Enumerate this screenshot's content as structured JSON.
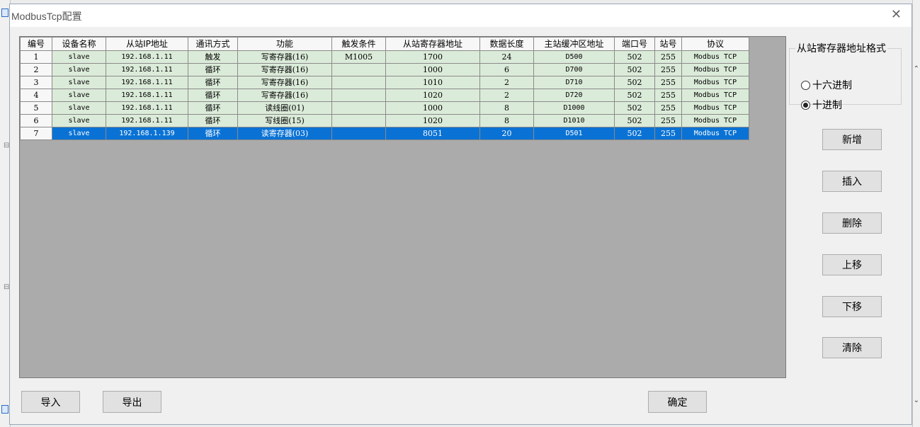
{
  "window": {
    "title": "ModbusTcp配置"
  },
  "table": {
    "headers": [
      "编号",
      "设备名称",
      "从站IP地址",
      "通讯方式",
      "功能",
      "触发条件",
      "从站寄存器地址",
      "数据长度",
      "主站缓冲区地址",
      "端口号",
      "站号",
      "协议"
    ],
    "rows": [
      [
        "1",
        "slave",
        "192.168.1.11",
        "触发",
        "写寄存器(16)",
        "M1005",
        "1700",
        "24",
        "D500",
        "502",
        "255",
        "Modbus TCP"
      ],
      [
        "2",
        "slave",
        "192.168.1.11",
        "循环",
        "写寄存器(16)",
        "",
        "1000",
        "6",
        "D700",
        "502",
        "255",
        "Modbus TCP"
      ],
      [
        "3",
        "slave",
        "192.168.1.11",
        "循环",
        "写寄存器(16)",
        "",
        "1010",
        "2",
        "D710",
        "502",
        "255",
        "Modbus TCP"
      ],
      [
        "4",
        "slave",
        "192.168.1.11",
        "循环",
        "写寄存器(16)",
        "",
        "1020",
        "2",
        "D720",
        "502",
        "255",
        "Modbus TCP"
      ],
      [
        "5",
        "slave",
        "192.168.1.11",
        "循环",
        "读线圈(01)",
        "",
        "1000",
        "8",
        "D1000",
        "502",
        "255",
        "Modbus TCP"
      ],
      [
        "6",
        "slave",
        "192.168.1.11",
        "循环",
        "写线圈(15)",
        "",
        "1020",
        "8",
        "D1010",
        "502",
        "255",
        "Modbus TCP"
      ],
      [
        "7",
        "slave",
        "192.168.1.139",
        "循环",
        "读寄存器(03)",
        "",
        "8051",
        "20",
        "D501",
        "502",
        "255",
        "Modbus TCP"
      ]
    ],
    "selected_row": 6
  },
  "address_format": {
    "legend": "从站寄存器地址格式",
    "options": [
      "十六进制",
      "十进制"
    ],
    "selected": "十进制"
  },
  "buttons": {
    "add": "新增",
    "insert": "插入",
    "delete": "删除",
    "move_up": "上移",
    "move_down": "下移",
    "clear": "清除",
    "import": "导入",
    "export": "导出",
    "ok": "确定"
  },
  "colors": {
    "row_bg": "#dbebd9",
    "selected_bg": "#0a72d4",
    "grid_empty_bg": "#ababab"
  }
}
